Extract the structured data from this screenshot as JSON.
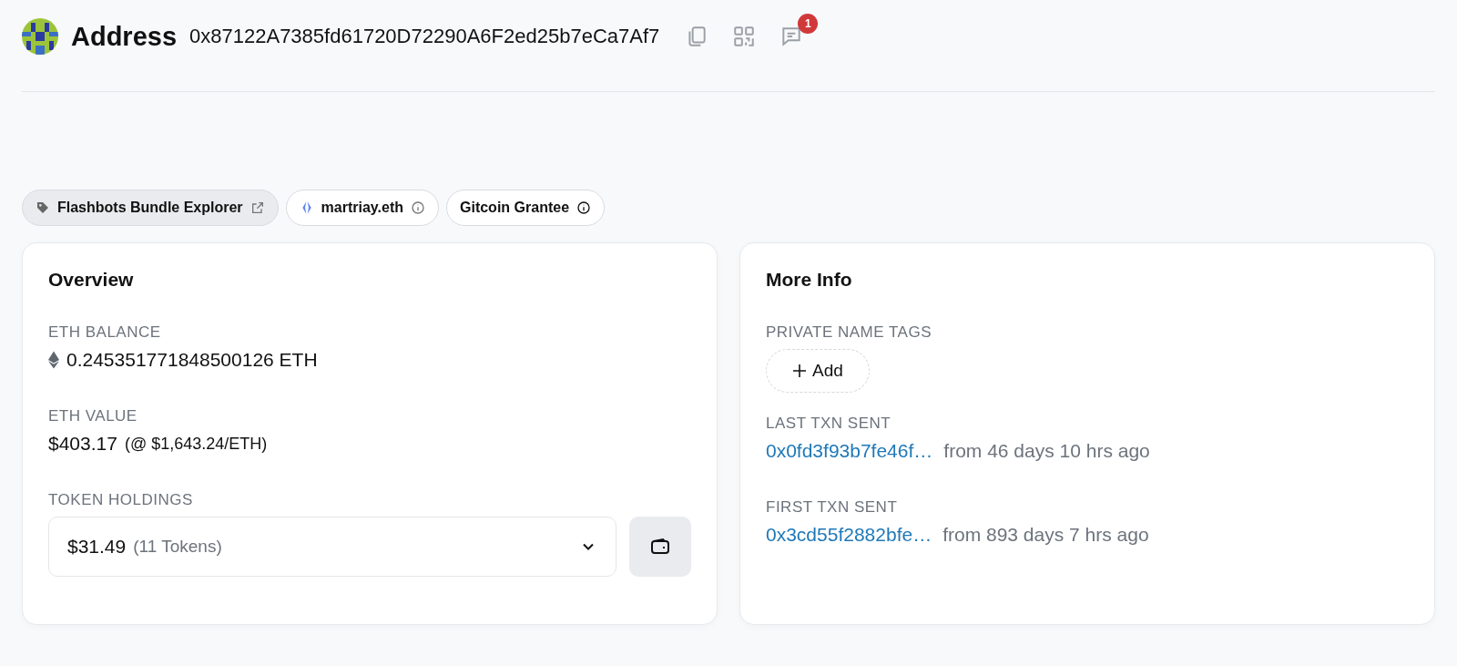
{
  "header": {
    "title": "Address",
    "address": "0x87122A7385fd61720D72290A6F2ed25b7eCa7Af7",
    "notification_count": "1"
  },
  "tags": [
    {
      "kind": "label",
      "label": "Flashbots Bundle Explorer"
    },
    {
      "kind": "ens",
      "label": "martriay.eth"
    },
    {
      "kind": "plain",
      "label": "Gitcoin Grantee"
    }
  ],
  "overview": {
    "title": "Overview",
    "eth_balance_label": "ETH BALANCE",
    "eth_balance": "0.245351771848500126 ETH",
    "eth_value_label": "ETH VALUE",
    "eth_value": "$403.17",
    "eth_price": "(@ $1,643.24/ETH)",
    "token_holdings_label": "TOKEN HOLDINGS",
    "token_value": "$31.49",
    "token_count": "(11 Tokens)"
  },
  "more_info": {
    "title": "More Info",
    "private_tags_label": "PRIVATE NAME TAGS",
    "add_button": "Add",
    "last_txn_label": "LAST TXN SENT",
    "last_txn_hash": "0x0fd3f93b7fe46f…",
    "last_txn_age": "from 46 days 10 hrs ago",
    "first_txn_label": "FIRST TXN SENT",
    "first_txn_hash": "0x3cd55f2882bfe…",
    "first_txn_age": "from 893 days 7 hrs ago"
  }
}
